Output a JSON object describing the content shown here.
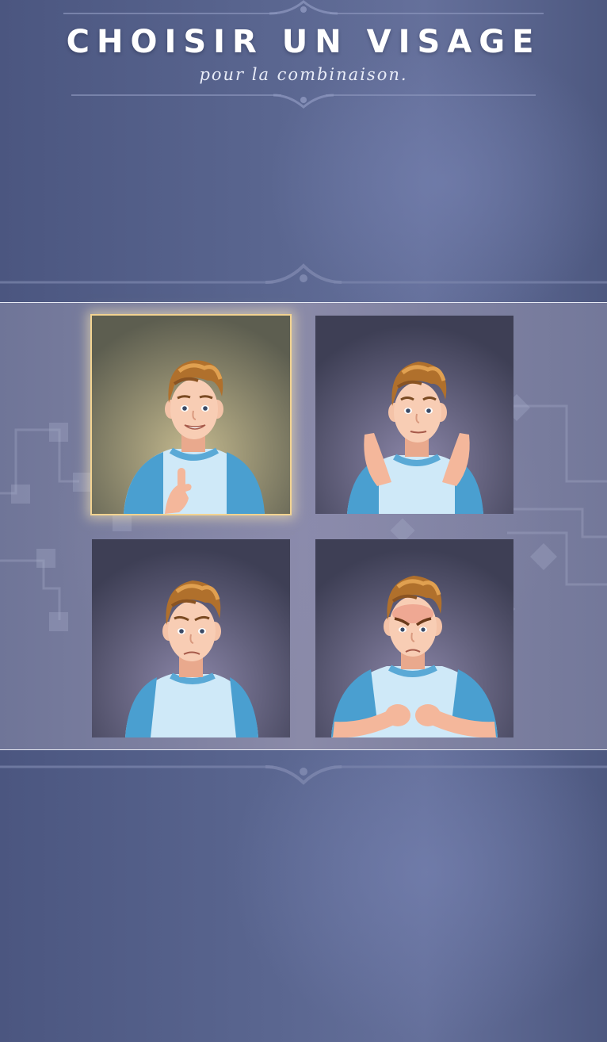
{
  "header": {
    "title": "CHOISIR UN VISAGE",
    "subtitle": "pour la combinaison."
  },
  "faces": [
    {
      "expression": "thumbs-up-smile",
      "selected": true
    },
    {
      "expression": "clapping-happy",
      "selected": false
    },
    {
      "expression": "sad",
      "selected": false
    },
    {
      "expression": "angry-fists",
      "selected": false
    }
  ],
  "colors": {
    "background": "#5a6690",
    "selection_border": "#f2d391",
    "shirt": "#cfe9f8",
    "sleeve": "#4a9fd0",
    "hair": "#b0702c"
  }
}
